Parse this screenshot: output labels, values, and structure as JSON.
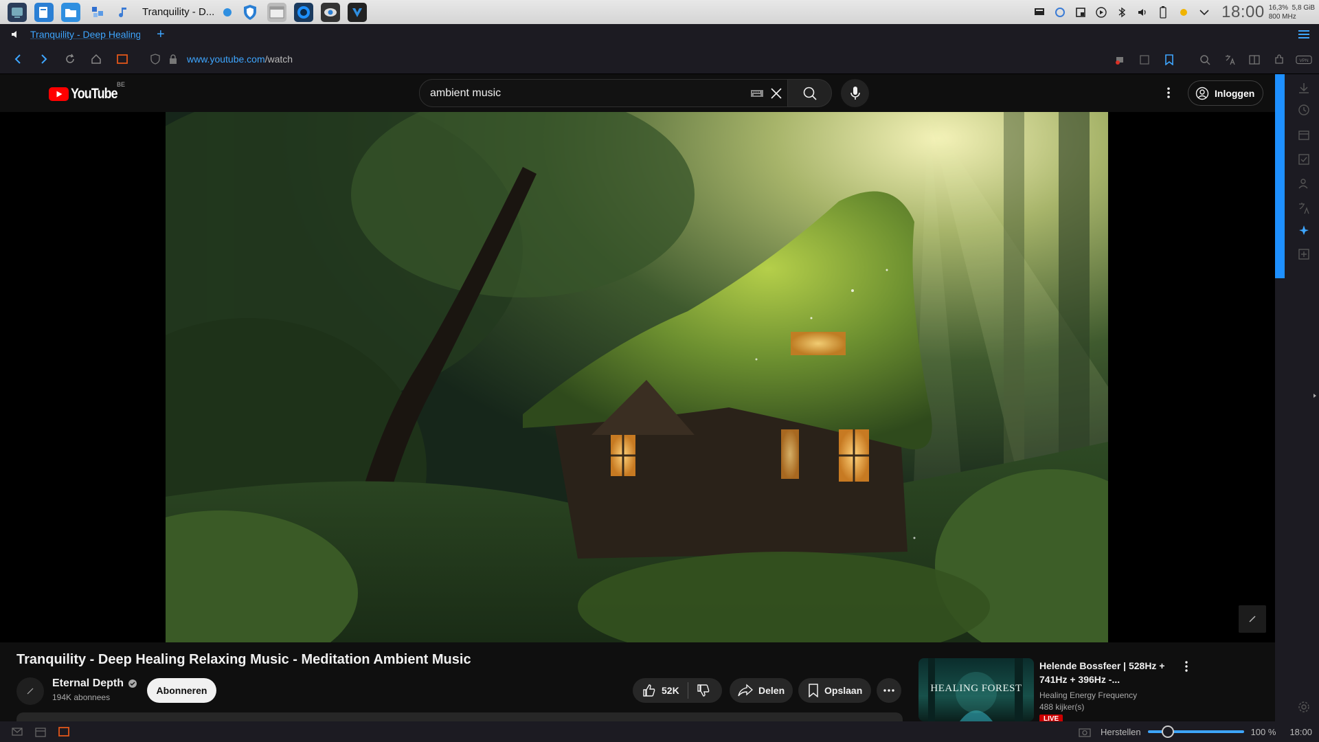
{
  "taskbar": {
    "task_title": "Tranquility - D...",
    "clock": "18:00",
    "cpu": "16,3%",
    "cpu_freq": "800 MHz",
    "memory": "5,8 GiB"
  },
  "browser": {
    "tab_title": "Tranquility - Deep Healing",
    "url_host": "www.youtube.com",
    "url_path": "/watch",
    "accent_color": "#3ea6ff"
  },
  "youtube": {
    "logo_text": "YouTube",
    "country_code": "BE",
    "search_query": "ambient music",
    "signin_label": "Inloggen",
    "video": {
      "title": "Tranquility - Deep Healing Relaxing Music - Meditation Ambient Music",
      "channel": "Eternal Depth",
      "subscribers": "194K abonnees",
      "subscribe_label": "Abonneren",
      "likes": "52K",
      "share_label": "Delen",
      "save_label": "Opslaan"
    },
    "recommendation": {
      "thumb_text": "HEALING FOREST",
      "title": "Helende Bossfeer | 528Hz + 741Hz + 396Hz -...",
      "channel": "Healing Energy Frequency",
      "viewers": "488 kijker(s)",
      "badge": "LIVE"
    }
  },
  "statusbar": {
    "restore_label": "Herstellen",
    "zoom": "100 %",
    "clock": "18:00"
  }
}
